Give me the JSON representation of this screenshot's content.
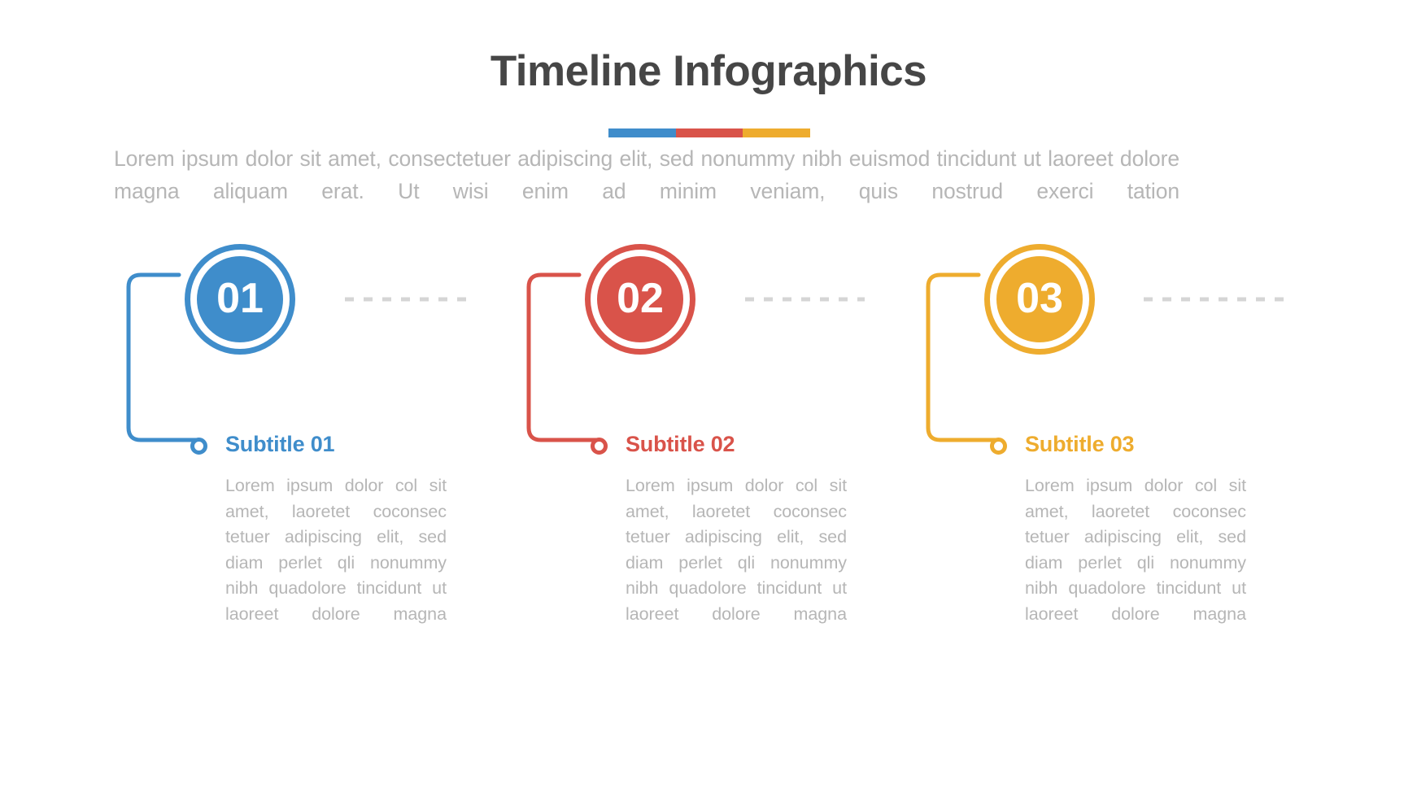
{
  "header": {
    "title": "Timeline Infographics",
    "divider_colors": [
      "#3f8dcb",
      "#d9534a",
      "#eeac2e"
    ],
    "title_color": "#464646",
    "intro_paragraph": "Lorem ipsum dolor sit amet, consectetuer adipiscing elit, sed nonummy nibh euismod tincidunt ut laoreet dolore magna aliquam erat. Ut wisi enim ad minim veniam, quis nostrud exerci tation",
    "intro_color": "#b6b6b6"
  },
  "timeline": {
    "connector_color": "#d5d5d5",
    "connector_style": "dashed",
    "steps": [
      {
        "number": "01",
        "subtitle": "Subtitle 01",
        "body": "Lorem ipsum dolor col sit amet, laoretet coconsec tetuer adipiscing elit, sed diam perlet qli nonummy nibh quadolore tincidunt ut laoreet dolore magna",
        "color": "#3f8dcb"
      },
      {
        "number": "02",
        "subtitle": "Subtitle 02",
        "body": "Lorem ipsum dolor col sit amet, laoretet coconsec tetuer adipiscing elit, sed diam perlet qli nonummy nibh quadolore tincidunt ut laoreet dolore magna",
        "color": "#d9534a"
      },
      {
        "number": "03",
        "subtitle": "Subtitle 03",
        "body": "Lorem ipsum dolor col sit amet, laoretet coconsec tetuer adipiscing elit, sed diam perlet qli nonummy nibh quadolore tincidunt ut laoreet dolore magna",
        "color": "#eeac2e"
      }
    ]
  }
}
